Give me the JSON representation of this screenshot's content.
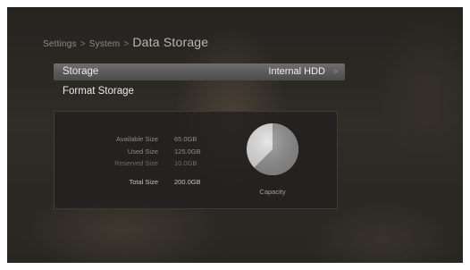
{
  "breadcrumb": {
    "items": [
      "Settings",
      "System"
    ],
    "separator": ">",
    "current": "Data Storage"
  },
  "menu": {
    "storage": {
      "label": "Storage",
      "value": "Internal HDD",
      "arrow": ">"
    },
    "format": {
      "label": "Format Storage"
    }
  },
  "stats": {
    "available": {
      "label": "Available Size",
      "value": "65.0GB"
    },
    "used": {
      "label": "Used Size",
      "value": "125.0GB"
    },
    "reserved": {
      "label": "Reserved Size",
      "value": "10.0GB"
    },
    "total": {
      "label": "Total Size",
      "value": "200.0GB"
    }
  },
  "capacity": {
    "label": "Capacity",
    "used_fraction": 0.625,
    "colors": {
      "used": "#8f8f8f",
      "available": "#dedede",
      "reserved": "#5e5e5e"
    }
  }
}
